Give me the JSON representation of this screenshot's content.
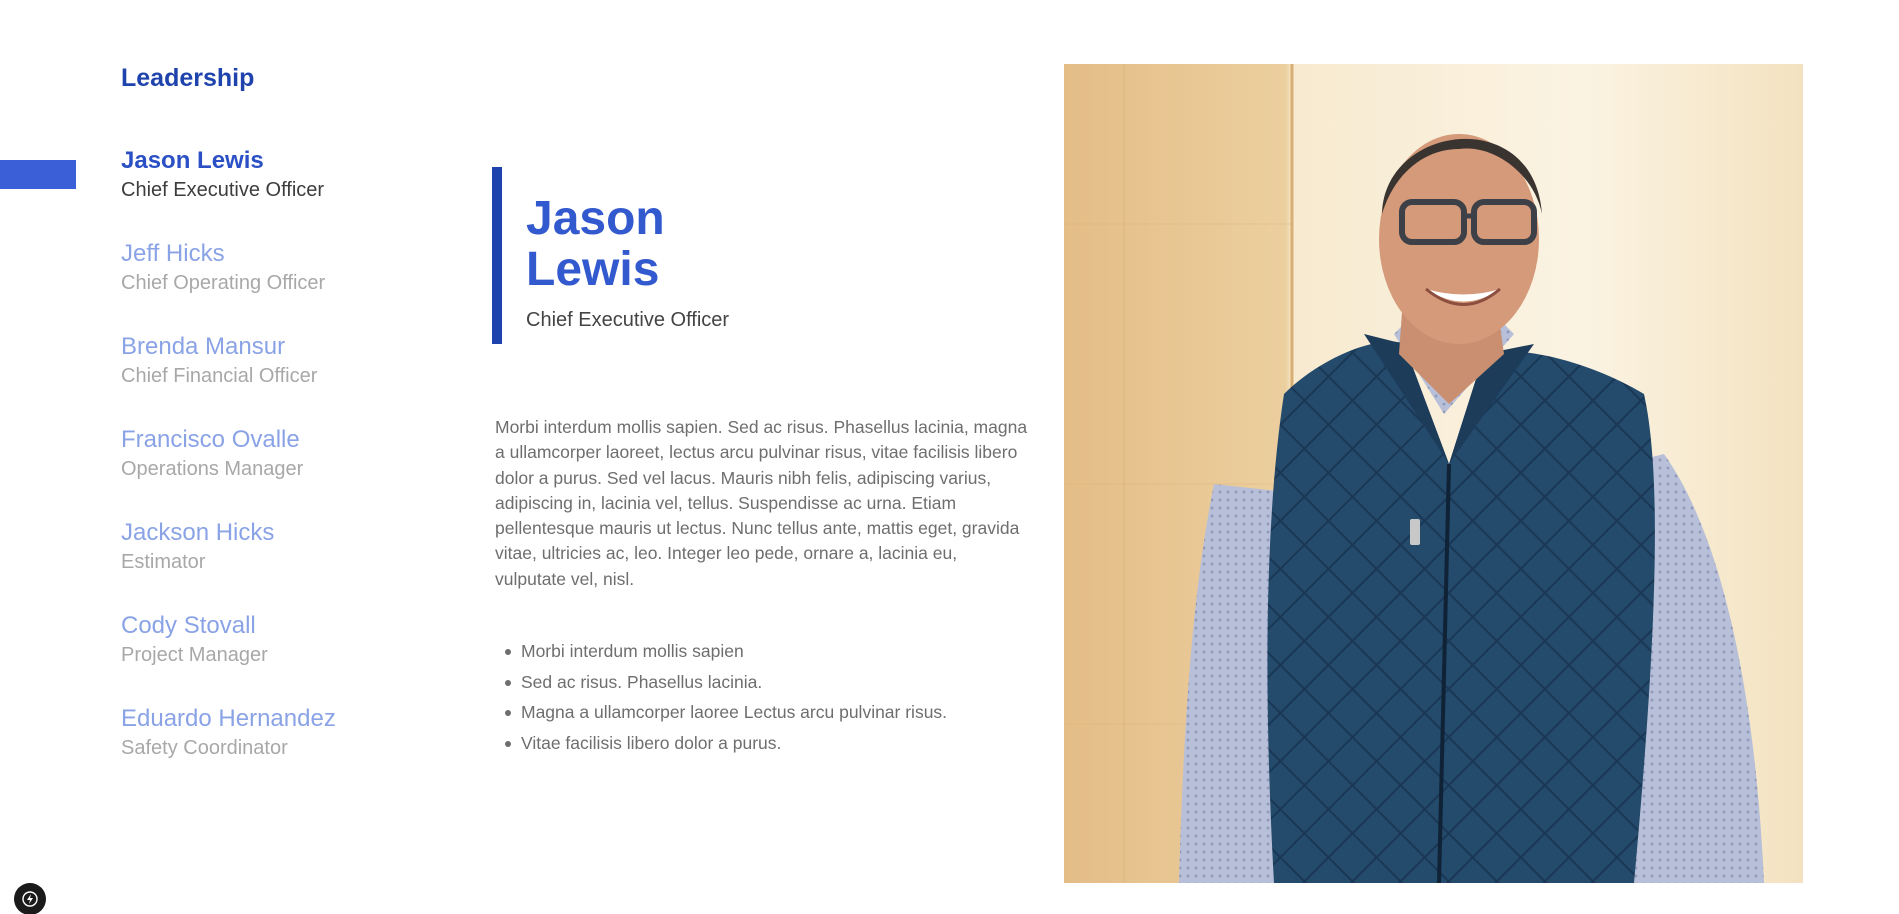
{
  "section_title": "Leadership",
  "leaders": [
    {
      "name": "Jason Lewis",
      "role": "Chief Executive Officer",
      "active": true
    },
    {
      "name": "Jeff Hicks",
      "role": "Chief Operating Officer",
      "active": false
    },
    {
      "name": "Brenda Mansur",
      "role": "Chief Financial Officer",
      "active": false
    },
    {
      "name": "Francisco Ovalle",
      "role": "Operations Manager",
      "active": false
    },
    {
      "name": "Jackson Hicks",
      "role": "Estimator",
      "active": false
    },
    {
      "name": "Cody Stovall",
      "role": "Project Manager",
      "active": false
    },
    {
      "name": "Eduardo Hernandez",
      "role": "Safety Coordinator",
      "active": false
    }
  ],
  "profile": {
    "name": "Jason Lewis",
    "title": "Chief Executive Officer",
    "bio": "Morbi interdum mollis sapien. Sed ac risus. Phasellus lacinia, magna a ullamcorper laoreet, lectus arcu pulvinar risus, vitae facilisis libero dolor a purus. Sed vel lacus. Mauris nibh felis, adipiscing varius, adipiscing in, lacinia vel, tellus. Suspendisse ac urna. Etiam pellentesque mauris ut lectus. Nunc tellus ante, mattis eget, gravida vitae, ultricies ac, leo. Integer leo pede, ornare a, lacinia eu, vulputate vel, nisl.",
    "highlights": [
      "Morbi interdum mollis sapien",
      "Sed ac risus. Phasellus lacinia.",
      "Magna a ullamcorper laoree Lectus arcu pulvinar risus.",
      "Vitae facilisis libero dolor a purus."
    ]
  },
  "colors": {
    "accent": "#1f43ad",
    "active_name": "#2b50c5",
    "inactive_name": "#8aa3e6",
    "active_bar": "#3a5fd6"
  },
  "icons": {
    "badge": "lightning-bolt-icon"
  }
}
